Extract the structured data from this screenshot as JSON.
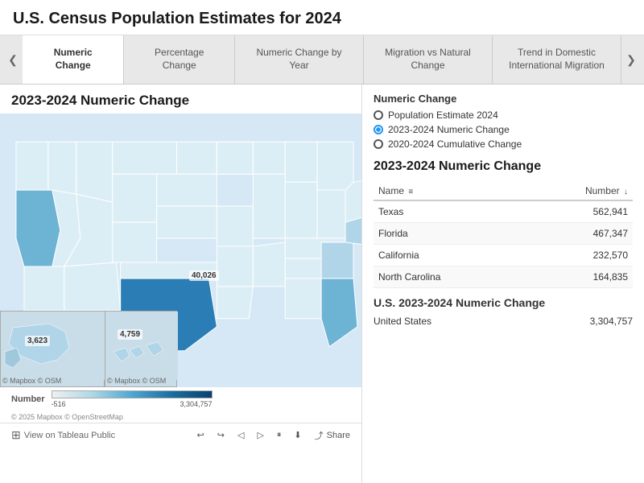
{
  "title": "U.S. Census Population Estimates for 2024",
  "tabs": [
    {
      "label": "Numeric Change",
      "active": true
    },
    {
      "label": "Percentage Change",
      "active": false
    },
    {
      "label": "Numeric Change by Year",
      "active": false
    },
    {
      "label": "Migration vs Natural Change",
      "active": false
    },
    {
      "label": "Trend in Domestic International Migration",
      "active": false
    }
  ],
  "nav": {
    "prev_arrow": "❮",
    "next_arrow": "❯"
  },
  "map": {
    "title": "2023-2024 Numeric Change",
    "label_texas": "40,026",
    "label_alaska": "3,623",
    "label_hawaii": "4,759",
    "mapbox_credit1": "© Mapbox  © OSM",
    "mapbox_credit2": "© Mapbox  © OSM"
  },
  "legend": {
    "label": "Number",
    "min": "-516",
    "max": "3,304,757"
  },
  "filter": {
    "title": "Numeric Change",
    "options": [
      {
        "label": "Population Estimate 2024",
        "selected": false
      },
      {
        "label": "2023-2024 Numeric Change",
        "selected": true
      },
      {
        "label": "2020-2024 Cumulative Change",
        "selected": false
      }
    ]
  },
  "table": {
    "title": "2023-2024 Numeric Change",
    "col_name": "Name",
    "col_sort_name": "≡",
    "col_number": "Number",
    "col_sort_number": "↓",
    "rows": [
      {
        "name": "Texas",
        "number": "562,941"
      },
      {
        "name": "Florida",
        "number": "467,347"
      },
      {
        "name": "California",
        "number": "232,570"
      },
      {
        "name": "North Carolina",
        "number": "164,835"
      }
    ]
  },
  "summary": {
    "title": "U.S. 2023-2024 Numeric Change",
    "row_name": "United States",
    "row_value": "3,304,757"
  },
  "footer": {
    "view_label": "View on Tableau Public",
    "copyright": "© 2025 Mapbox  © OpenStreetMap",
    "undo_icon": "↩",
    "redo_icon": "↪",
    "back_icon": "◁",
    "forward_icon": "▷",
    "pause_icon": "⏸",
    "download_icon": "⬇",
    "share_icon": "⤴",
    "share_label": "Share"
  }
}
